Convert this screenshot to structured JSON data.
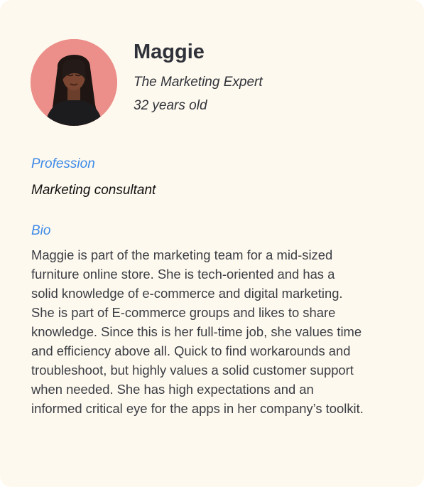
{
  "persona": {
    "name": "Maggie",
    "role": "The Marketing Expert",
    "age": "32 years old",
    "avatar_alt": "Maggie avatar"
  },
  "profession": {
    "label": "Profession",
    "value": "Marketing consultant"
  },
  "bio": {
    "label": "Bio",
    "text": "Maggie is part of the marketing team for a mid-sized furniture online store. She is tech-oriented and has a solid knowledge of e-commerce and digital marketing. She is part of E-commerce groups and likes to share knowledge. Since this is her full-time job, she values time and efficiency above all. Quick to find workarounds and troubleshoot, but highly values a solid customer support when needed. She has high expectations and an informed critical eye for the apps in her company’s toolkit."
  },
  "colors": {
    "card_background": "#fef9ee",
    "accent_label": "#3d8ae8",
    "avatar_background": "#ec8f8a"
  }
}
